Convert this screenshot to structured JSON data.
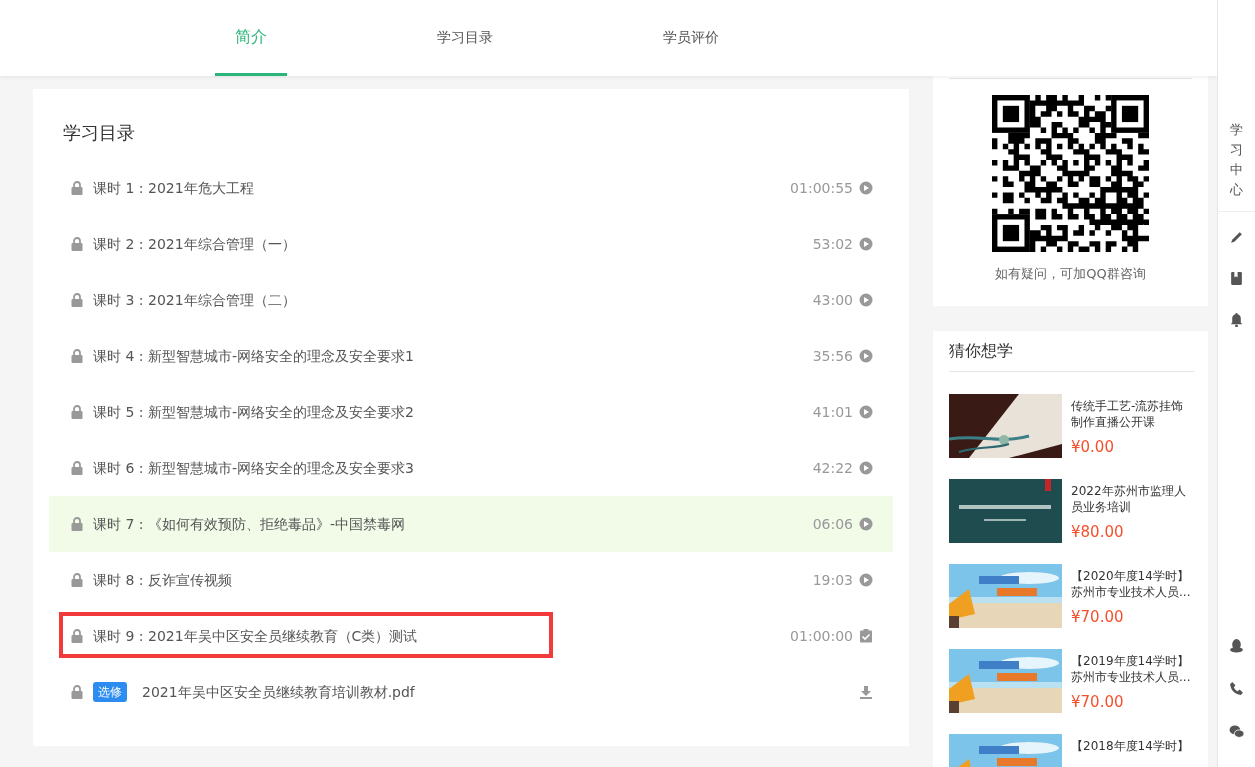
{
  "tabs": [
    {
      "label": "简介",
      "selected": true
    },
    {
      "label": "学习目录",
      "selected": false
    },
    {
      "label": "学员评价",
      "selected": false
    }
  ],
  "catalog": {
    "title": "学习目录",
    "lessons": [
      {
        "kind": "video",
        "label": "课时 1 : 2021年危大工程",
        "duration": "01:00:55",
        "locked": true,
        "highlighted": false,
        "marked": false
      },
      {
        "kind": "video",
        "label": "课时 2 : 2021年综合管理（一）",
        "duration": "53:02",
        "locked": true,
        "highlighted": false,
        "marked": false
      },
      {
        "kind": "video",
        "label": "课时 3 : 2021年综合管理（二）",
        "duration": "43:00",
        "locked": true,
        "highlighted": false,
        "marked": false
      },
      {
        "kind": "video",
        "label": "课时 4 : 新型智慧城市-网络安全的理念及安全要求1",
        "duration": "35:56",
        "locked": true,
        "highlighted": false,
        "marked": false
      },
      {
        "kind": "video",
        "label": "课时 5 : 新型智慧城市-网络安全的理念及安全要求2",
        "duration": "41:01",
        "locked": true,
        "highlighted": false,
        "marked": false
      },
      {
        "kind": "video",
        "label": "课时 6 : 新型智慧城市-网络安全的理念及安全要求3",
        "duration": "42:22",
        "locked": true,
        "highlighted": false,
        "marked": false
      },
      {
        "kind": "video",
        "label": "课时 7 : 《如何有效预防、拒绝毒品》-中国禁毒网",
        "duration": "06:06",
        "locked": true,
        "highlighted": true,
        "marked": false
      },
      {
        "kind": "video",
        "label": "课时 8 : 反诈宣传视频",
        "duration": "19:03",
        "locked": true,
        "highlighted": false,
        "marked": false
      },
      {
        "kind": "exam",
        "label": "课时 9 : 2021年吴中区安全员继续教育（C类）测试",
        "duration": "01:00:00",
        "locked": true,
        "highlighted": false,
        "marked": true
      },
      {
        "kind": "file",
        "tag": "选修",
        "label": "2021年吴中区安全员继续教育培训教材.pdf",
        "locked": true,
        "highlighted": false,
        "marked": false
      }
    ]
  },
  "qr_card": {
    "caption": "如有疑问，可加QQ群咨询"
  },
  "suggestions": {
    "title": "猜你想学",
    "courses": [
      {
        "title": "传统手工艺-流苏挂饰制作直播公开课",
        "price": "¥0.00"
      },
      {
        "title": "2022年苏州市监理人员业务培训",
        "price": "¥80.00"
      },
      {
        "title": "【2020年度14学时】苏州市专业技术人员...",
        "price": "¥70.00"
      },
      {
        "title": "【2019年度14学时】苏州市专业技术人员...",
        "price": "¥70.00"
      },
      {
        "title": "【2018年度14学时】"
      }
    ]
  },
  "toolbar": {
    "label": "学习中心"
  }
}
